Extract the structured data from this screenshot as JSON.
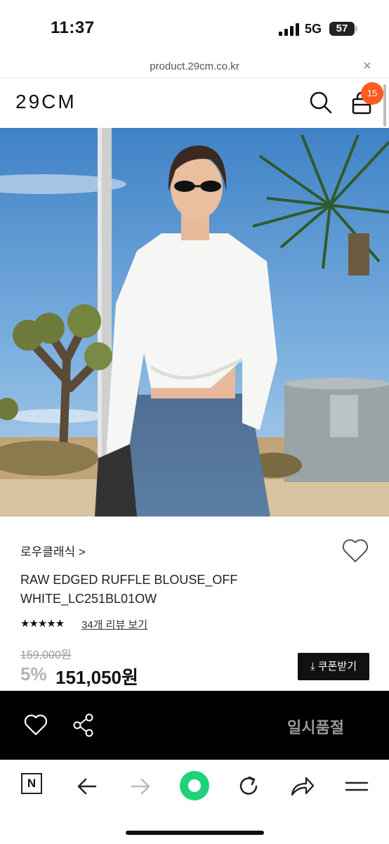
{
  "status_bar": {
    "time": "11:37",
    "network": "5G",
    "battery": "57"
  },
  "url_bar": {
    "url": "product.29cm.co.kr",
    "close": "×"
  },
  "header": {
    "logo": "29CM",
    "cart_count": "15"
  },
  "product": {
    "brand": "로우클래식 >",
    "title": "RAW EDGED RUFFLE BLOUSE_OFF WHITE_LC251BL01OW",
    "stars": "★★★★★",
    "rating_value": 4.5,
    "review_link": "34개 리뷰 보기",
    "original_price": "159,000원",
    "discount": "5%",
    "price": "151,050원",
    "coupon_button": "⤓ 쿠폰받기"
  },
  "action_bar": {
    "status": "일시품절"
  },
  "toolbar": {
    "n_label": "N"
  },
  "colors": {
    "accent": "#ff5a1f",
    "green": "#1fd27a",
    "dark": "#000000"
  }
}
